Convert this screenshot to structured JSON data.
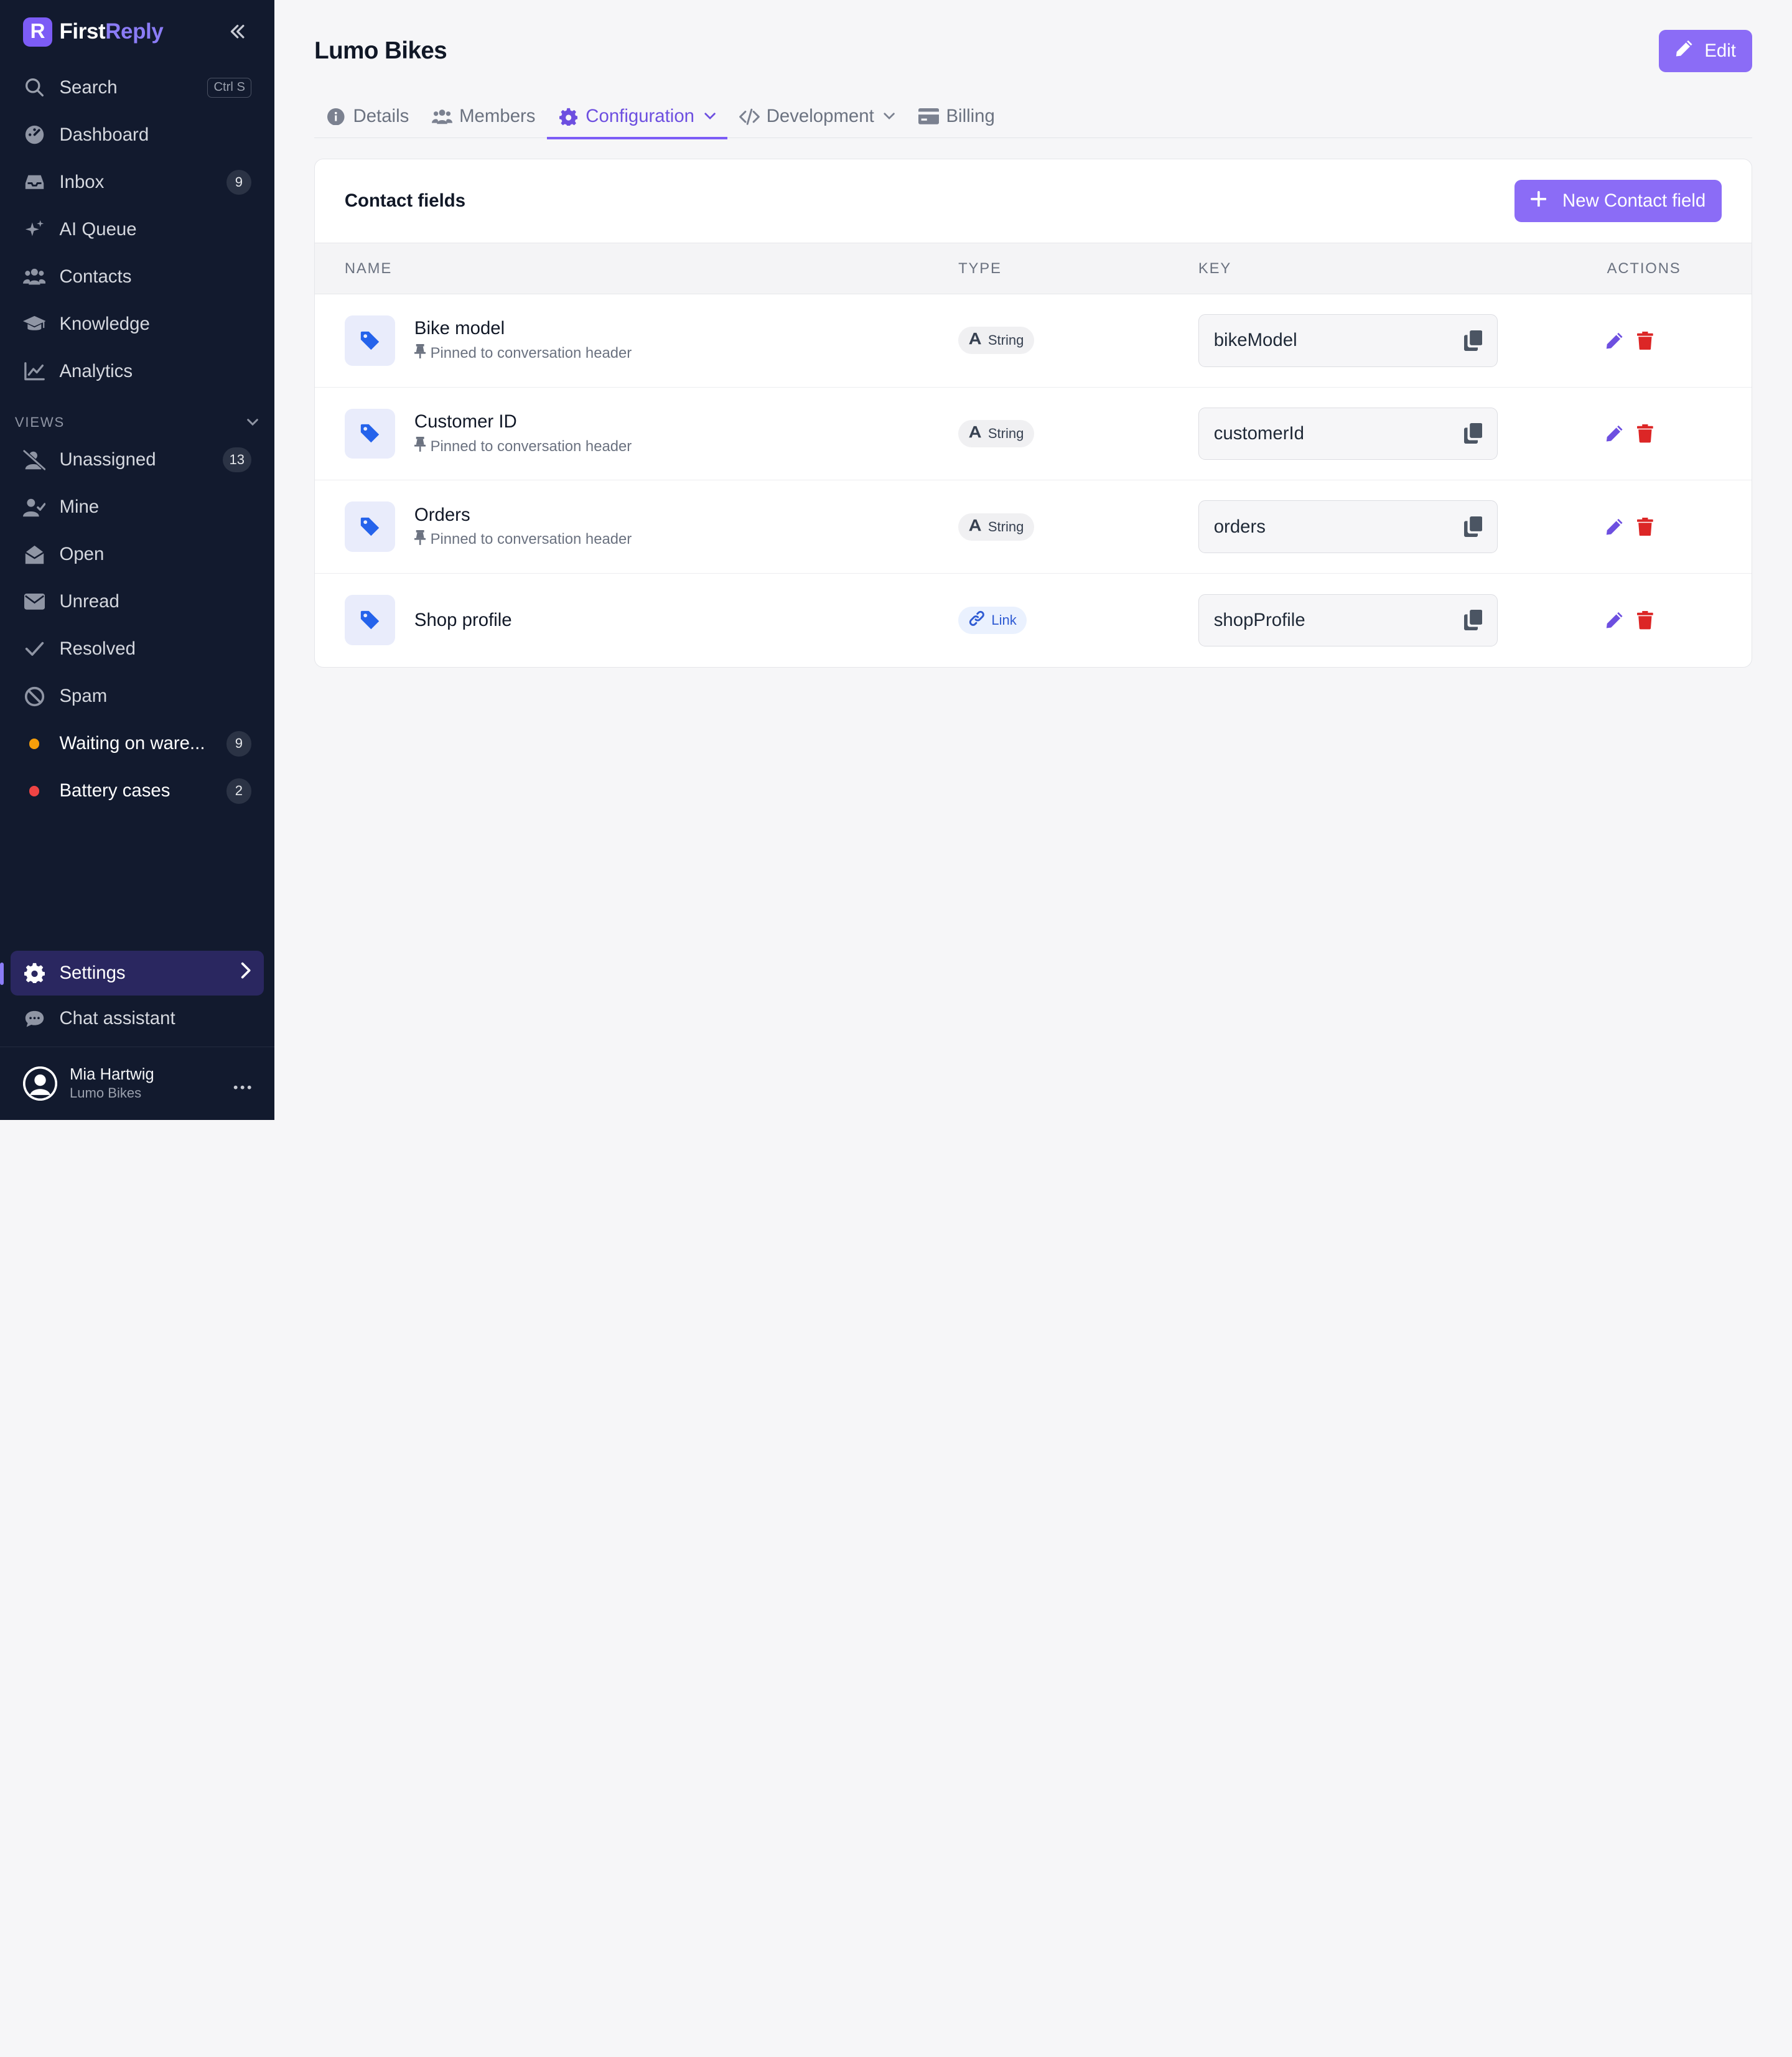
{
  "app": {
    "brand_first": "First",
    "brand_second": "Reply",
    "brand_letter": "R"
  },
  "sidebar": {
    "search": {
      "label": "Search",
      "shortcut": "Ctrl S"
    },
    "items": [
      {
        "label": "Dashboard",
        "icon": "dashboard-icon"
      },
      {
        "label": "Inbox",
        "icon": "inbox-icon",
        "badge": "9"
      },
      {
        "label": "AI Queue",
        "icon": "sparkles-icon"
      },
      {
        "label": "Contacts",
        "icon": "users-icon"
      },
      {
        "label": "Knowledge",
        "icon": "graduation-cap-icon"
      },
      {
        "label": "Analytics",
        "icon": "chart-line-icon"
      }
    ],
    "views_label": "VIEWS",
    "views": [
      {
        "label": "Unassigned",
        "icon": "user-slash-icon",
        "badge": "13"
      },
      {
        "label": "Mine",
        "icon": "user-check-icon"
      },
      {
        "label": "Open",
        "icon": "envelope-open-icon"
      },
      {
        "label": "Unread",
        "icon": "envelope-icon"
      },
      {
        "label": "Resolved",
        "icon": "check-icon"
      },
      {
        "label": "Spam",
        "icon": "ban-icon"
      },
      {
        "label": "Waiting on ware...",
        "dot_color": "#f59e0b",
        "badge": "9"
      },
      {
        "label": "Battery cases",
        "dot_color": "#ef4444",
        "badge": "2"
      }
    ],
    "settings_label": "Settings",
    "chat_label": "Chat assistant",
    "user": {
      "name": "Mia Hartwig",
      "org": "Lumo Bikes"
    }
  },
  "page": {
    "title": "Lumo Bikes",
    "edit_label": "Edit",
    "tabs": [
      {
        "label": "Details",
        "icon": "info-icon"
      },
      {
        "label": "Members",
        "icon": "users-icon"
      },
      {
        "label": "Configuration",
        "icon": "gear-icon",
        "active": true
      },
      {
        "label": "Development",
        "icon": "code-icon"
      },
      {
        "label": "Billing",
        "icon": "credit-card-icon"
      }
    ]
  },
  "contact_fields": {
    "title": "Contact fields",
    "new_label": "New Contact field",
    "columns": {
      "name": "NAME",
      "type": "TYPE",
      "key": "KEY",
      "actions": "ACTIONS"
    },
    "rows": [
      {
        "name": "Bike model",
        "sub": "Pinned to conversation header",
        "type": "String",
        "key": "bikeModel"
      },
      {
        "name": "Customer ID",
        "sub": "Pinned to conversation header",
        "type": "String",
        "key": "customerId"
      },
      {
        "name": "Orders",
        "sub": "Pinned to conversation header",
        "type": "String",
        "key": "orders"
      },
      {
        "name": "Shop profile",
        "sub": "",
        "type": "Link",
        "key": "shopProfile"
      }
    ]
  },
  "colors": {
    "accent": "#8b6cf6",
    "sidebar_bg": "#121a2e",
    "delete": "#dc2626",
    "tag_blue": "#2563eb"
  }
}
